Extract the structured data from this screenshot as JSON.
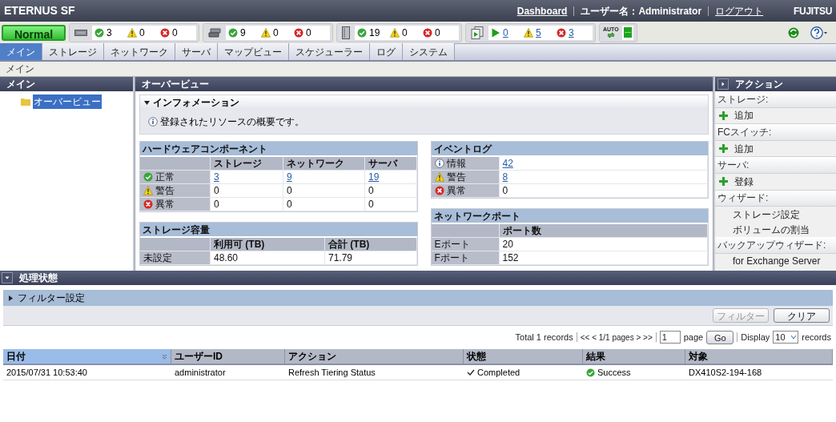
{
  "header": {
    "title": "ETERNUS SF",
    "dashboard_link": "Dashboard",
    "user": "ユーザー名：Administrator",
    "logout_link": "ログアウト",
    "logo": "FUJITSU"
  },
  "toolbar": {
    "status": "Normal",
    "groups": [
      {
        "kind": "storage",
        "counts": [
          {
            "kind": "ok",
            "value": "3",
            "link": false
          },
          {
            "kind": "warning",
            "value": "0",
            "link": false
          },
          {
            "kind": "error",
            "value": "0",
            "link": false
          }
        ]
      },
      {
        "kind": "network",
        "counts": [
          {
            "kind": "ok",
            "value": "9",
            "link": false
          },
          {
            "kind": "warning",
            "value": "0",
            "link": false
          },
          {
            "kind": "error",
            "value": "0",
            "link": false
          }
        ]
      },
      {
        "kind": "server",
        "counts": [
          {
            "kind": "ok",
            "value": "19",
            "link": false
          },
          {
            "kind": "warning",
            "value": "0",
            "link": false
          },
          {
            "kind": "error",
            "value": "0",
            "link": false
          }
        ]
      },
      {
        "kind": "job",
        "counts": [
          {
            "kind": "run",
            "value": "0",
            "link": true
          },
          {
            "kind": "warning",
            "value": "5",
            "link": true
          },
          {
            "kind": "error",
            "value": "3",
            "link": true
          }
        ]
      }
    ],
    "auto_label": "AUTO"
  },
  "tabs": [
    {
      "label": "メイン",
      "selected": true
    },
    {
      "label": "ストレージ",
      "selected": false
    },
    {
      "label": "ネットワーク",
      "selected": false
    },
    {
      "label": "サーバ",
      "selected": false
    },
    {
      "label": "マップビュー",
      "selected": false
    },
    {
      "label": "スケジューラー",
      "selected": false
    },
    {
      "label": "ログ",
      "selected": false
    },
    {
      "label": "システム",
      "selected": false
    }
  ],
  "breadcrumb": "メイン",
  "sidebar": {
    "title": "メイン",
    "items": [
      {
        "label": "オーバービュー",
        "selected": true
      }
    ]
  },
  "overview": {
    "title": "オーバービュー",
    "information": {
      "title": "インフォメーション",
      "expanded": true,
      "message": "登録されたリソースの概要です。"
    },
    "hardware": {
      "title": "ハードウェアコンポーネント",
      "columns": [
        "ストレージ",
        "ネットワーク",
        "サーバ"
      ],
      "rows": [
        {
          "kind": "ok",
          "label": "正常",
          "cells": [
            {
              "text": "3",
              "link": true
            },
            {
              "text": "9",
              "link": true
            },
            {
              "text": "19",
              "link": true
            }
          ]
        },
        {
          "kind": "warning",
          "label": "警告",
          "cells": [
            {
              "text": "0",
              "link": false
            },
            {
              "text": "0",
              "link": false
            },
            {
              "text": "0",
              "link": false
            }
          ]
        },
        {
          "kind": "error",
          "label": "異常",
          "cells": [
            {
              "text": "0",
              "link": false
            },
            {
              "text": "0",
              "link": false
            },
            {
              "text": "0",
              "link": false
            }
          ]
        }
      ]
    },
    "capacity": {
      "title": "ストレージ容量",
      "columns": [
        "利用可 (TB)",
        "合計 (TB)"
      ],
      "rows": [
        {
          "label": "未設定",
          "cells": [
            "48.60",
            "71.79"
          ]
        }
      ]
    },
    "event_log": {
      "title": "イベントログ",
      "rows": [
        {
          "kind": "info",
          "label": "情報",
          "value": "42",
          "link": true
        },
        {
          "kind": "warning",
          "label": "警告",
          "value": "8",
          "link": true
        },
        {
          "kind": "error",
          "label": "異常",
          "value": "0",
          "link": false
        }
      ]
    },
    "network_ports": {
      "title": "ネットワークポート",
      "columns": [
        "ポート数"
      ],
      "rows": [
        {
          "label": "Eポート",
          "value": "20"
        },
        {
          "label": "Fポート",
          "value": "152"
        }
      ]
    }
  },
  "actions": {
    "title": "アクション",
    "items": [
      {
        "kind": "header",
        "text": "ストレージ:"
      },
      {
        "kind": "add",
        "text": "追加"
      },
      {
        "kind": "header",
        "text": "FCスイッチ:"
      },
      {
        "kind": "add",
        "text": "追加"
      },
      {
        "kind": "header",
        "text": "サーバ:"
      },
      {
        "kind": "add",
        "text": "登録"
      },
      {
        "kind": "header",
        "text": "ウィザード:"
      },
      {
        "kind": "sub",
        "text": "ストレージ設定"
      },
      {
        "kind": "sub",
        "text": "ボリュームの割当"
      },
      {
        "kind": "header",
        "text": "バックアップウィザード:"
      },
      {
        "kind": "sub",
        "text": "for Exchange Server"
      }
    ]
  },
  "processing": {
    "title": "処理状態",
    "expanded": true,
    "filter": {
      "title": "フィルター設定",
      "expanded": false
    },
    "buttons": [
      {
        "label": "フィルター",
        "disabled": true
      },
      {
        "label": "クリア",
        "disabled": false
      }
    ],
    "pagination": {
      "total": "Total 1 records",
      "nav": "<< < 1/1 pages > >>",
      "page": "1",
      "page_label": "page",
      "go": "Go",
      "display_label": "Display",
      "display_value": "10",
      "records_label": "records"
    },
    "table": {
      "columns": [
        {
          "label": "日付",
          "selected": true
        },
        {
          "label": "ユーザーID",
          "selected": false
        },
        {
          "label": "アクション",
          "selected": false
        },
        {
          "label": "状態",
          "selected": false
        },
        {
          "label": "結果",
          "selected": false
        },
        {
          "label": "対象",
          "selected": false
        }
      ],
      "rows": [
        {
          "date": "2015/07/31 10:53:40",
          "user": "administrator",
          "action": "Refresh Tiering Status",
          "status": "Completed",
          "result": "Success",
          "target": "DX410S2-194-168"
        }
      ]
    }
  }
}
